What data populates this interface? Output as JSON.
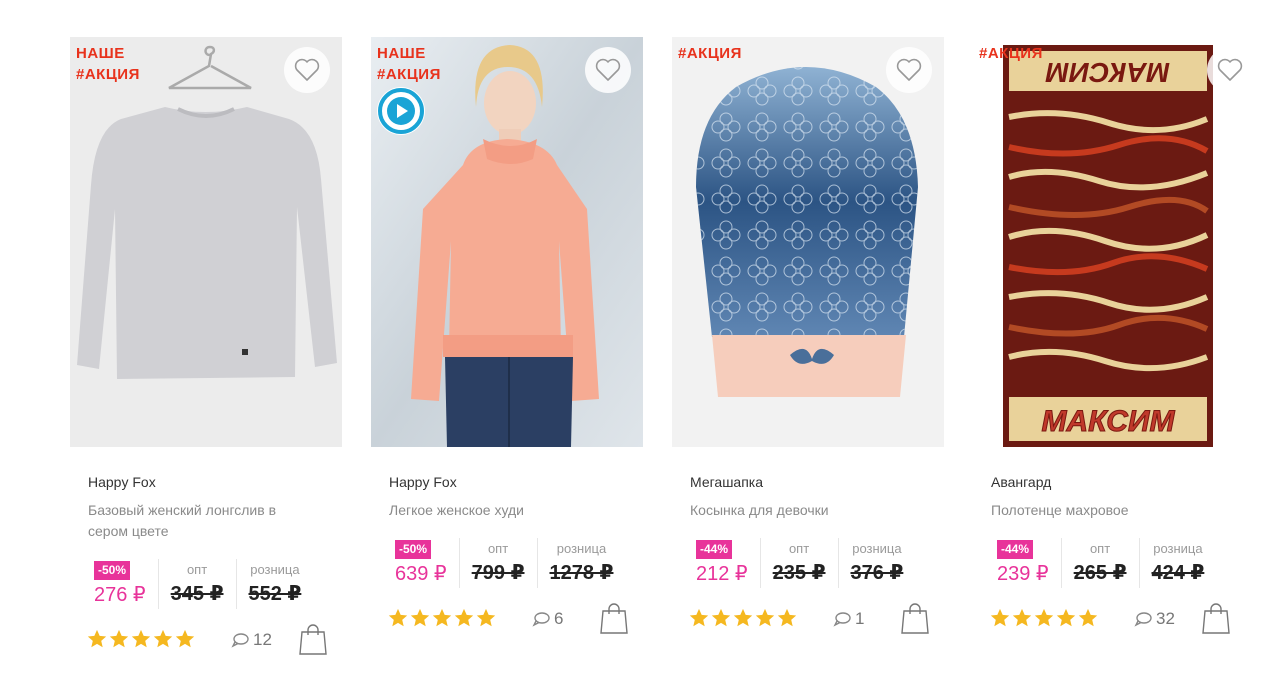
{
  "products": [
    {
      "badge": "НАШЕ\n#АКЦИЯ",
      "brand": "Happy Fox",
      "title": "Базовый женский лонгслив в сером цвете",
      "discount": "-50%",
      "opt_label": "опт",
      "retail_label": "розница",
      "price_now": "276 ₽",
      "price_opt": "345 ₽",
      "price_retail": "552 ₽",
      "rating": 5,
      "comments": "12"
    },
    {
      "badge": "НАШЕ\n#АКЦИЯ",
      "brand": "Happy Fox",
      "title": "Легкое женское худи",
      "discount": "-50%",
      "opt_label": "опт",
      "retail_label": "розница",
      "price_now": "639 ₽",
      "price_opt": "799 ₽",
      "price_retail": "1278 ₽",
      "rating": 5,
      "comments": "6"
    },
    {
      "badge": "#АКЦИЯ",
      "brand": "Мегашапка",
      "title": "Косынка для девочки",
      "discount": "-44%",
      "opt_label": "опт",
      "retail_label": "розница",
      "price_now": "212 ₽",
      "price_opt": "235 ₽",
      "price_retail": "376 ₽",
      "rating": 5,
      "comments": "1"
    },
    {
      "badge": "#АКЦИЯ",
      "brand": "Авангард",
      "title": "Полотенце махровое",
      "discount": "-44%",
      "opt_label": "опт",
      "retail_label": "розница",
      "price_now": "239 ₽",
      "price_opt": "265 ₽",
      "price_retail": "424 ₽",
      "rating": 5,
      "comments": "32"
    }
  ],
  "towel_text": "МАКСИМ",
  "colors": {
    "badge": "#e8321c",
    "accent": "#e8339a",
    "star": "#f5b820"
  },
  "icons": [
    "heart-icon",
    "play-icon",
    "star-icon",
    "comment-icon",
    "shopping-bag-icon"
  ]
}
